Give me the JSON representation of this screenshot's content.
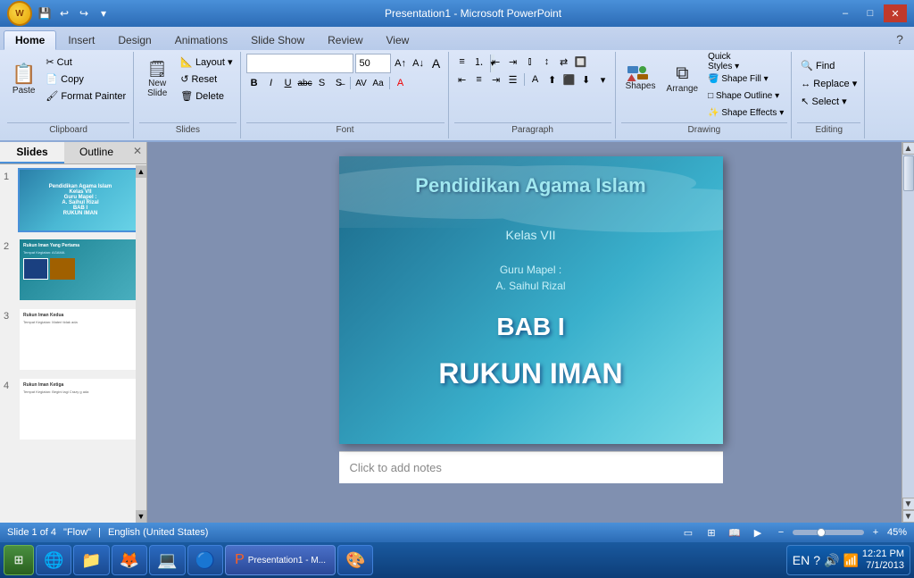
{
  "titlebar": {
    "title": "Presentation1 - Microsoft PowerPoint",
    "minimize": "–",
    "maximize": "□",
    "close": "✕"
  },
  "quickaccess": {
    "save": "💾",
    "undo": "↩",
    "redo": "↪",
    "customize": "▾"
  },
  "tabs": {
    "items": [
      "Home",
      "Insert",
      "Design",
      "Animations",
      "Slide Show",
      "Review",
      "View"
    ],
    "active": "Home"
  },
  "ribbon": {
    "groups": {
      "clipboard": {
        "label": "Clipboard",
        "paste": "Paste",
        "cut": "Cut",
        "copy": "Copy",
        "format_painter": "Format Painter"
      },
      "slides": {
        "label": "Slides",
        "new_slide": "New\nSlide",
        "layout": "Layout",
        "reset": "Reset",
        "delete": "Delete"
      },
      "font": {
        "label": "Font",
        "font_name": "",
        "font_size": "50",
        "bold": "B",
        "italic": "I",
        "underline": "U",
        "strikethrough": "abc",
        "shadow": "S",
        "clear": "A"
      },
      "paragraph": {
        "label": "Paragraph"
      },
      "drawing": {
        "label": "Drawing",
        "shapes": "Shapes",
        "arrange": "Arrange",
        "quick_styles": "Quick\nStyles"
      },
      "shapeformat": {
        "shape_fill": "Shape Fill",
        "shape_outline": "Shape Outline",
        "shape_effects": "Shape Effects"
      },
      "editing": {
        "label": "Editing",
        "find": "Find",
        "replace": "Replace",
        "select": "Select"
      }
    }
  },
  "slides_panel": {
    "tabs": [
      "Slides",
      "Outline"
    ],
    "slides": [
      {
        "num": "1",
        "title": "Pendidikan Agama Islam\nKelas VII\nGuru Mapel :\nA. Saihul Rizal\nBAB I\nRUKUN IMAN",
        "active": true
      },
      {
        "num": "2",
        "title": "Rukun Iman Yang Pertama\nTempat Kegiatan: AGAMA",
        "active": false
      },
      {
        "num": "3",
        "title": "Rukun Iman Kedua\nTempat Kegiatan: Materi tidak ada",
        "active": false
      },
      {
        "num": "4",
        "title": "Rukun Iman Ketiga\nTempat Kegiatan: Begini lagi Crazy g ada",
        "active": false
      }
    ]
  },
  "slide": {
    "title": "Pendidikan Agama Islam",
    "subtitle": "Kelas VII",
    "teacher_label": "Guru Mapel :",
    "teacher_name": "A. Saihul Rizal",
    "bab": "BAB I",
    "rukun": "RUKUN IMAN"
  },
  "notes": {
    "placeholder": "Click to add notes"
  },
  "statusbar": {
    "slide_info": "Slide 1 of 4",
    "theme": "\"Flow\"",
    "language": "English (United States)",
    "zoom": "45%"
  },
  "taskbar": {
    "apps": [
      {
        "icon": "🌐",
        "label": ""
      },
      {
        "icon": "📁",
        "label": ""
      },
      {
        "icon": "🦊",
        "label": ""
      },
      {
        "icon": "💻",
        "label": ""
      },
      {
        "icon": "🌐",
        "label": ""
      },
      {
        "icon": "📊",
        "label": ""
      },
      {
        "icon": "🎨",
        "label": ""
      }
    ]
  },
  "systray": {
    "lang": "EN",
    "help": "?",
    "time": "12:21 PM",
    "date": "7/1/2013"
  }
}
